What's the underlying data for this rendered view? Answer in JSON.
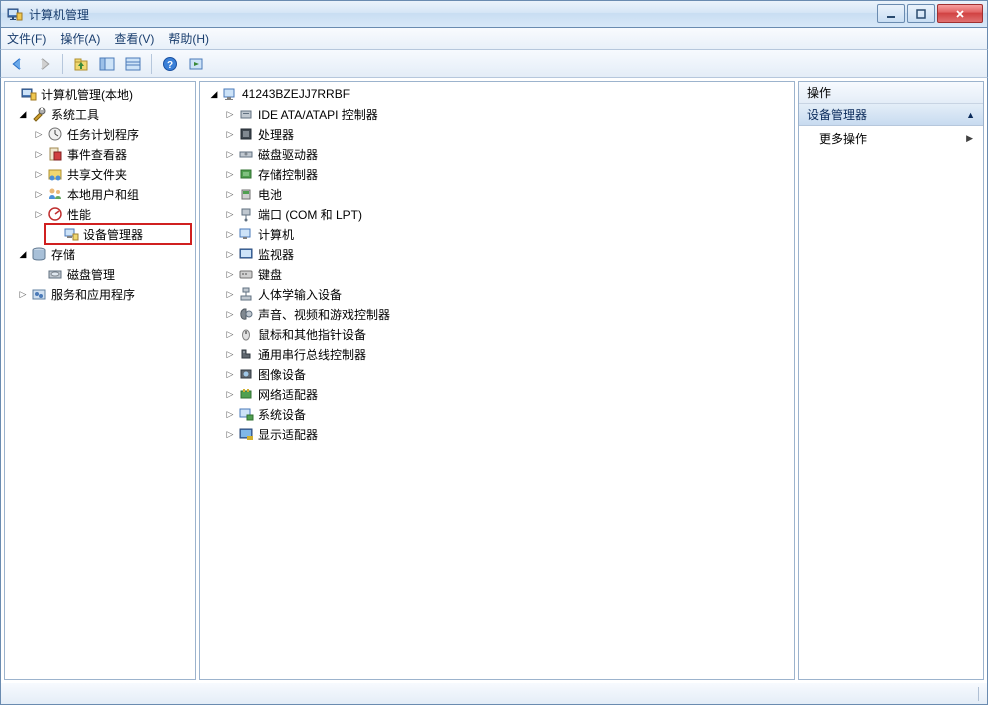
{
  "window": {
    "title": "计算机管理"
  },
  "menu": {
    "file": "文件(F)",
    "action": "操作(A)",
    "view": "查看(V)",
    "help": "帮助(H)"
  },
  "left_tree": {
    "root": "计算机管理(本地)",
    "system_tools": "系统工具",
    "task_scheduler": "任务计划程序",
    "event_viewer": "事件查看器",
    "shared_folders": "共享文件夹",
    "local_users": "本地用户和组",
    "performance": "性能",
    "device_manager": "设备管理器",
    "storage": "存储",
    "disk_management": "磁盘管理",
    "services_apps": "服务和应用程序"
  },
  "mid_tree": {
    "computer": "41243BZEJJ7RRBF",
    "items": [
      "IDE ATA/ATAPI 控制器",
      "处理器",
      "磁盘驱动器",
      "存储控制器",
      "电池",
      "端口 (COM 和 LPT)",
      "计算机",
      "监视器",
      "键盘",
      "人体学输入设备",
      "声音、视频和游戏控制器",
      "鼠标和其他指针设备",
      "通用串行总线控制器",
      "图像设备",
      "网络适配器",
      "系统设备",
      "显示适配器"
    ]
  },
  "actions": {
    "header": "操作",
    "subheader": "设备管理器",
    "more": "更多操作"
  }
}
